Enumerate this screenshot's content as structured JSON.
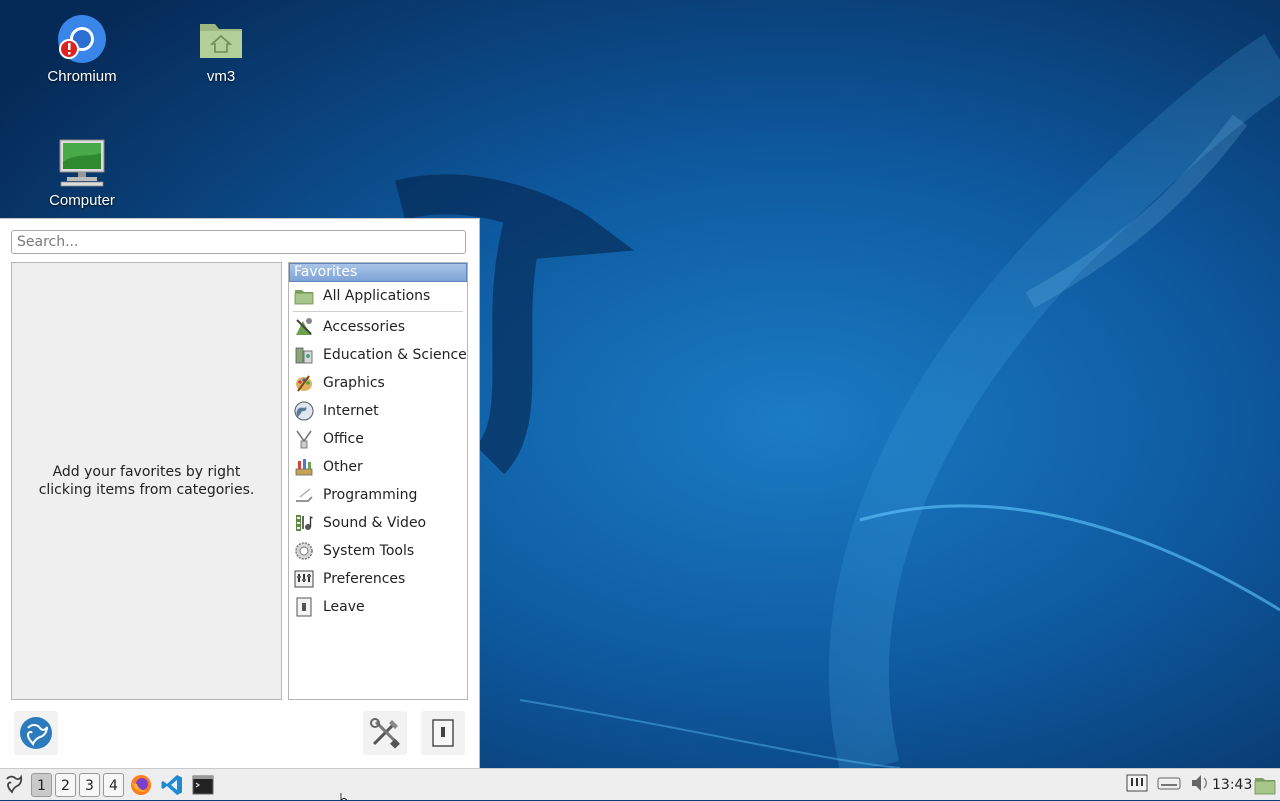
{
  "desktop": {
    "icons": [
      {
        "label": "Chromium"
      },
      {
        "label": "vm3"
      },
      {
        "label": "Computer"
      }
    ]
  },
  "menu": {
    "search_placeholder": "Search...",
    "favorites_hint": "Add your favorites by right clicking items from categories.",
    "categories_header": "Favorites",
    "categories": [
      {
        "label": "All Applications",
        "icon": "folder-icon"
      },
      {
        "label": "Accessories",
        "icon": "accessories-icon"
      },
      {
        "label": "Education & Science",
        "icon": "education-icon"
      },
      {
        "label": "Graphics",
        "icon": "graphics-icon"
      },
      {
        "label": "Internet",
        "icon": "globe-icon"
      },
      {
        "label": "Office",
        "icon": "office-icon"
      },
      {
        "label": "Other",
        "icon": "other-icon"
      },
      {
        "label": "Programming",
        "icon": "programming-icon"
      },
      {
        "label": "Sound & Video",
        "icon": "sound-video-icon"
      },
      {
        "label": "System Tools",
        "icon": "gear-icon"
      },
      {
        "label": "Preferences",
        "icon": "preferences-icon"
      },
      {
        "label": "Leave",
        "icon": "leave-icon"
      }
    ]
  },
  "panel": {
    "workspaces": [
      "1",
      "2",
      "3",
      "4"
    ],
    "active_workspace": "1",
    "clock": "13:43"
  },
  "colors": {
    "wallpaper_dark": "#062a57",
    "wallpaper_light": "#1b7cc4",
    "selection": "#7ea3d6"
  }
}
